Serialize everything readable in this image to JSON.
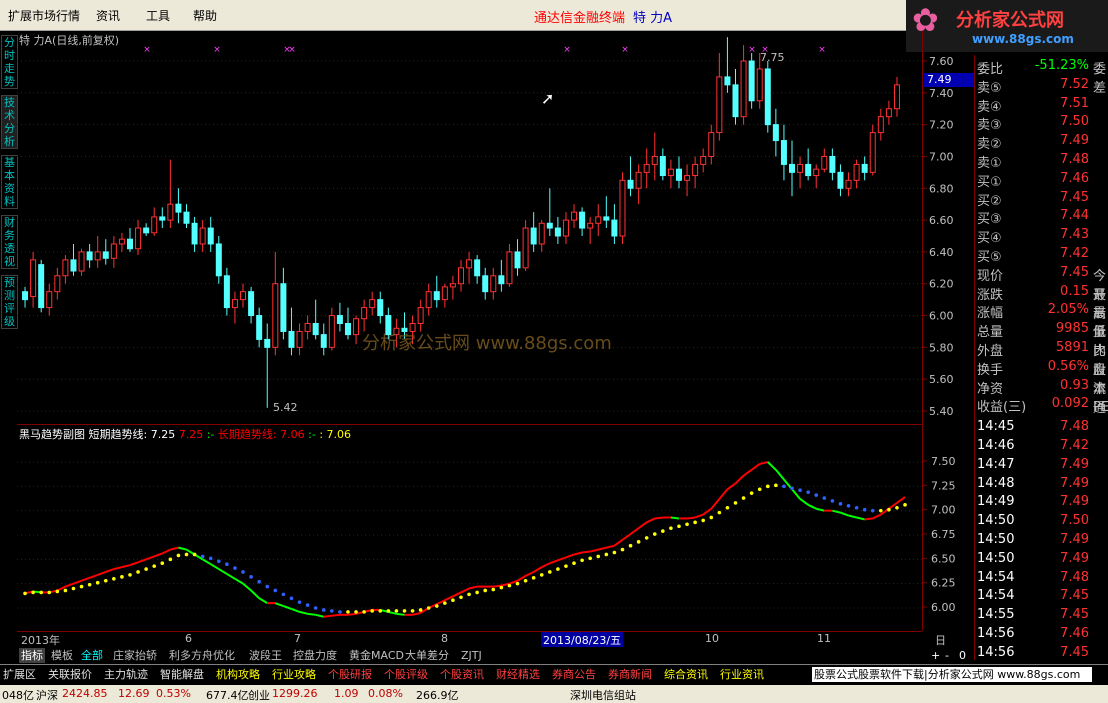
{
  "menubar": {
    "items": [
      "扩展市场行情",
      "资讯",
      "工具",
      "帮助"
    ],
    "app_title": "通达信金融终端",
    "stock_title": "特  力A",
    "logo_text": "分析家公式网",
    "logo_url": "www.88gs.com"
  },
  "sidetabs": [
    "分时走势",
    "技术分析",
    "基本资料",
    "财务透视",
    "预测评级"
  ],
  "main_chart": {
    "header": "特  力A(日线,前复权)",
    "price_axis": [
      "7.60",
      "7.40",
      "7.20",
      "7.00",
      "6.80",
      "6.60",
      "6.40",
      "6.20",
      "6.00",
      "5.80",
      "5.60",
      "5.40"
    ],
    "current_price_tag": "7.49",
    "high_label": "7.75",
    "low_label": "5.42",
    "watermark": "分析家公式网 www.88gs.com"
  },
  "sub_chart": {
    "title": "黑马趋势副图",
    "short_label": "短期趋势线:",
    "short_value": "7.25",
    "short_value2": "7.25",
    "dash1": ":-",
    "long_label": "长期趋势线:",
    "long_value": "7.06",
    "dash2": ":-",
    "long_value2": ": 7.06",
    "axis": [
      "7.50",
      "7.25",
      "7.00",
      "6.75",
      "6.50",
      "6.25",
      "6.00"
    ]
  },
  "xaxis": {
    "labels": [
      "2013年",
      "6",
      "7",
      "8",
      "2013/08/23/五",
      "10",
      "11"
    ],
    "period": "日线"
  },
  "bottom_tabs": [
    "指标",
    "模板",
    "全部",
    "庄家抬轿",
    "利多方舟优化",
    "波段王",
    "控盘力度",
    "黄金MACD",
    "大单差分",
    "ZJTJ"
  ],
  "bottom_ctrl": [
    "+",
    "-",
    "0"
  ],
  "funcbar": {
    "items": [
      "扩展区",
      "关联报价",
      "主力轨迹",
      "智能解盘",
      "机构攻略",
      "行业攻略",
      "个股研报",
      "个股评级",
      "个股资讯",
      "财经精选",
      "券商公告",
      "券商新闻",
      "综合资讯",
      "行业资讯"
    ],
    "ad": "股票公式股票软件下载|分析家公式网 www.88gs.com"
  },
  "statusbar": {
    "seg0": "048亿",
    "sh_label": "沪深",
    "sh_value": "2424.85",
    "sh_change": "12.69",
    "sh_pct": "0.53%",
    "sh_amount": "677.4亿",
    "cy_label": "创业",
    "cy_value": "1299.26",
    "cy_change": "1.09",
    "cy_pct": "0.08%",
    "cy_amount": "266.9亿",
    "tail": "深圳电信组站"
  },
  "quote": {
    "weibi": {
      "label": "委比",
      "value": "-51.23%",
      "right": "委差"
    },
    "sells": [
      {
        "label": "卖⑤",
        "price": "7.52"
      },
      {
        "label": "卖④",
        "price": "7.51"
      },
      {
        "label": "卖③",
        "price": "7.50"
      },
      {
        "label": "卖②",
        "price": "7.49"
      },
      {
        "label": "卖①",
        "price": "7.48"
      }
    ],
    "buys": [
      {
        "label": "买①",
        "price": "7.46"
      },
      {
        "label": "买②",
        "price": "7.45"
      },
      {
        "label": "买③",
        "price": "7.44"
      },
      {
        "label": "买④",
        "price": "7.43"
      },
      {
        "label": "买⑤",
        "price": "7.42"
      }
    ],
    "stats": [
      {
        "label": "现价",
        "value": "7.45",
        "right": "今开"
      },
      {
        "label": "涨跌",
        "value": "0.15",
        "right": "最高"
      },
      {
        "label": "涨幅",
        "value": "2.05%",
        "right": "最低"
      },
      {
        "label": "总量",
        "value": "9985",
        "right": "量比"
      },
      {
        "label": "外盘",
        "value": "5891",
        "right": "内盘"
      },
      {
        "label": "换手",
        "value": "0.56%",
        "right": "股本"
      },
      {
        "label": "净资",
        "value": "0.93",
        "right": "流通"
      },
      {
        "label": "收益(三)",
        "value": "0.092",
        "right": "PE(动"
      }
    ],
    "ticks": [
      {
        "time": "14:45",
        "price": "7.48",
        "color": "#ff3232"
      },
      {
        "time": "14:46",
        "price": "7.42",
        "color": "#ff3232"
      },
      {
        "time": "14:47",
        "price": "7.49",
        "color": "#ff3232"
      },
      {
        "time": "14:48",
        "price": "7.49",
        "color": "#ff3232"
      },
      {
        "time": "14:49",
        "price": "7.49",
        "color": "#ff3232"
      },
      {
        "time": "14:50",
        "price": "7.50",
        "color": "#ff3232"
      },
      {
        "time": "14:50",
        "price": "7.49",
        "color": "#ff3232"
      },
      {
        "time": "14:50",
        "price": "7.49",
        "color": "#ff3232"
      },
      {
        "time": "14:54",
        "price": "7.48",
        "color": "#ff3232"
      },
      {
        "time": "14:54",
        "price": "7.45",
        "color": "#ff3232"
      },
      {
        "time": "14:55",
        "price": "7.45",
        "color": "#ff3232"
      },
      {
        "time": "14:56",
        "price": "7.46",
        "color": "#ff3232"
      },
      {
        "time": "14:56",
        "price": "7.45",
        "color": "#ff3232"
      }
    ]
  },
  "colors": {
    "up": "#ff3232",
    "down": "#54ffff",
    "ma_short_up": "#ff0000",
    "ma_short_down": "#00ff00",
    "ma_long": "#ffff00",
    "ma_long_dots": "#3060ff",
    "grid": "#800000",
    "label_cyan": "#00c0c0"
  },
  "chart_data": {
    "type": "candlestick",
    "xlabel": "",
    "ylabel": "",
    "ylim": [
      5.4,
      7.6
    ],
    "ohlc": [
      [
        6.15,
        6.18,
        6.05,
        6.1
      ],
      [
        6.12,
        6.4,
        6.05,
        6.35
      ],
      [
        6.32,
        6.35,
        6.02,
        6.05
      ],
      [
        6.05,
        6.2,
        6.0,
        6.15
      ],
      [
        6.15,
        6.3,
        6.1,
        6.25
      ],
      [
        6.25,
        6.38,
        6.2,
        6.35
      ],
      [
        6.35,
        6.45,
        6.25,
        6.28
      ],
      [
        6.28,
        6.42,
        6.25,
        6.4
      ],
      [
        6.4,
        6.45,
        6.3,
        6.35
      ],
      [
        6.35,
        6.5,
        6.3,
        6.4
      ],
      [
        6.4,
        6.48,
        6.32,
        6.36
      ],
      [
        6.36,
        6.5,
        6.3,
        6.45
      ],
      [
        6.45,
        6.52,
        6.4,
        6.48
      ],
      [
        6.48,
        6.55,
        6.4,
        6.42
      ],
      [
        6.42,
        6.6,
        6.38,
        6.55
      ],
      [
        6.55,
        6.58,
        6.5,
        6.52
      ],
      [
        6.52,
        6.68,
        6.5,
        6.62
      ],
      [
        6.62,
        6.68,
        6.55,
        6.6
      ],
      [
        6.6,
        6.98,
        6.55,
        6.7
      ],
      [
        6.7,
        6.8,
        6.58,
        6.65
      ],
      [
        6.65,
        6.7,
        6.55,
        6.58
      ],
      [
        6.58,
        6.62,
        6.4,
        6.45
      ],
      [
        6.45,
        6.6,
        6.4,
        6.55
      ],
      [
        6.55,
        6.62,
        6.4,
        6.45
      ],
      [
        6.45,
        6.5,
        6.2,
        6.25
      ],
      [
        6.25,
        6.3,
        6.0,
        6.05
      ],
      [
        6.05,
        6.15,
        5.95,
        6.1
      ],
      [
        6.1,
        6.2,
        6.05,
        6.15
      ],
      [
        6.15,
        6.18,
        5.95,
        6.0
      ],
      [
        6.0,
        6.05,
        5.8,
        5.85
      ],
      [
        5.85,
        5.95,
        5.42,
        5.8
      ],
      [
        5.8,
        6.4,
        5.75,
        6.2
      ],
      [
        6.2,
        6.3,
        5.85,
        5.9
      ],
      [
        5.9,
        6.05,
        5.75,
        5.8
      ],
      [
        5.8,
        5.95,
        5.75,
        5.9
      ],
      [
        5.9,
        6.0,
        5.85,
        5.95
      ],
      [
        5.95,
        6.1,
        5.85,
        5.88
      ],
      [
        5.88,
        5.95,
        5.75,
        5.8
      ],
      [
        5.8,
        6.05,
        5.78,
        6.0
      ],
      [
        6.0,
        6.08,
        5.9,
        5.95
      ],
      [
        5.95,
        6.05,
        5.85,
        5.88
      ],
      [
        5.88,
        6.0,
        5.82,
        5.98
      ],
      [
        5.98,
        6.1,
        5.9,
        6.05
      ],
      [
        6.05,
        6.15,
        6.0,
        6.1
      ],
      [
        6.1,
        6.15,
        5.95,
        6.0
      ],
      [
        6.0,
        6.05,
        5.85,
        5.88
      ],
      [
        5.88,
        5.98,
        5.8,
        5.92
      ],
      [
        5.92,
        6.02,
        5.85,
        5.9
      ],
      [
        5.9,
        6.0,
        5.82,
        5.95
      ],
      [
        5.95,
        6.1,
        5.9,
        6.05
      ],
      [
        6.05,
        6.2,
        6.0,
        6.15
      ],
      [
        6.15,
        6.25,
        6.05,
        6.1
      ],
      [
        6.1,
        6.2,
        6.05,
        6.18
      ],
      [
        6.18,
        6.25,
        6.1,
        6.2
      ],
      [
        6.2,
        6.35,
        6.15,
        6.3
      ],
      [
        6.3,
        6.4,
        6.2,
        6.35
      ],
      [
        6.35,
        6.38,
        6.2,
        6.25
      ],
      [
        6.25,
        6.3,
        6.1,
        6.15
      ],
      [
        6.15,
        6.3,
        6.1,
        6.25
      ],
      [
        6.25,
        6.35,
        6.15,
        6.2
      ],
      [
        6.2,
        6.45,
        6.18,
        6.4
      ],
      [
        6.4,
        6.48,
        6.25,
        6.3
      ],
      [
        6.3,
        6.6,
        6.28,
        6.55
      ],
      [
        6.55,
        6.65,
        6.4,
        6.45
      ],
      [
        6.45,
        6.6,
        6.4,
        6.58
      ],
      [
        6.58,
        6.8,
        6.5,
        6.55
      ],
      [
        6.55,
        6.62,
        6.45,
        6.5
      ],
      [
        6.5,
        6.65,
        6.45,
        6.6
      ],
      [
        6.6,
        6.7,
        6.55,
        6.65
      ],
      [
        6.65,
        6.68,
        6.5,
        6.55
      ],
      [
        6.55,
        6.62,
        6.45,
        6.58
      ],
      [
        6.58,
        6.7,
        6.5,
        6.62
      ],
      [
        6.62,
        6.75,
        6.55,
        6.6
      ],
      [
        6.6,
        6.7,
        6.45,
        6.5
      ],
      [
        6.5,
        6.9,
        6.45,
        6.85
      ],
      [
        6.85,
        7.0,
        6.75,
        6.8
      ],
      [
        6.8,
        6.95,
        6.7,
        6.9
      ],
      [
        6.9,
        7.05,
        6.8,
        6.95
      ],
      [
        6.95,
        7.15,
        6.85,
        7.0
      ],
      [
        7.0,
        7.05,
        6.85,
        6.88
      ],
      [
        6.88,
        6.98,
        6.8,
        6.92
      ],
      [
        6.92,
        7.0,
        6.8,
        6.85
      ],
      [
        6.85,
        6.95,
        6.75,
        6.88
      ],
      [
        6.88,
        7.0,
        6.8,
        6.95
      ],
      [
        6.95,
        7.05,
        6.9,
        7.0
      ],
      [
        7.0,
        7.2,
        6.95,
        7.15
      ],
      [
        7.15,
        7.65,
        7.1,
        7.5
      ],
      [
        7.5,
        7.75,
        7.4,
        7.45
      ],
      [
        7.45,
        7.55,
        7.2,
        7.25
      ],
      [
        7.25,
        7.7,
        7.2,
        7.6
      ],
      [
        7.6,
        7.65,
        7.3,
        7.35
      ],
      [
        7.35,
        7.65,
        7.3,
        7.55
      ],
      [
        7.55,
        7.6,
        7.15,
        7.2
      ],
      [
        7.2,
        7.3,
        7.0,
        7.1
      ],
      [
        7.1,
        7.2,
        6.85,
        6.95
      ],
      [
        6.95,
        7.1,
        6.75,
        6.9
      ],
      [
        6.9,
        7.0,
        6.8,
        6.95
      ],
      [
        6.95,
        7.05,
        6.85,
        6.88
      ],
      [
        6.88,
        6.95,
        6.8,
        6.92
      ],
      [
        6.92,
        7.05,
        6.9,
        7.0
      ],
      [
        7.0,
        7.05,
        6.85,
        6.9
      ],
      [
        6.9,
        6.95,
        6.75,
        6.8
      ],
      [
        6.8,
        6.9,
        6.75,
        6.85
      ],
      [
        6.85,
        6.98,
        6.8,
        6.95
      ],
      [
        6.95,
        7.0,
        6.85,
        6.9
      ],
      [
        6.9,
        7.2,
        6.88,
        7.15
      ],
      [
        7.15,
        7.3,
        7.1,
        7.25
      ],
      [
        7.25,
        7.35,
        7.2,
        7.3
      ],
      [
        7.3,
        7.5,
        7.25,
        7.45
      ]
    ],
    "short_trend": [
      6.15,
      6.17,
      6.16,
      6.16,
      6.18,
      6.22,
      6.25,
      6.28,
      6.31,
      6.34,
      6.37,
      6.4,
      6.42,
      6.44,
      6.47,
      6.5,
      6.53,
      6.56,
      6.6,
      6.62,
      6.6,
      6.55,
      6.5,
      6.45,
      6.4,
      6.35,
      6.3,
      6.25,
      6.18,
      6.1,
      6.05,
      6.05,
      6.02,
      5.99,
      5.96,
      5.94,
      5.93,
      5.91,
      5.92,
      5.93,
      5.93,
      5.94,
      5.96,
      5.98,
      5.98,
      5.96,
      5.94,
      5.93,
      5.93,
      5.95,
      6.0,
      6.04,
      6.08,
      6.12,
      6.16,
      6.2,
      6.22,
      6.22,
      6.22,
      6.23,
      6.25,
      6.28,
      6.33,
      6.37,
      6.42,
      6.46,
      6.49,
      6.52,
      6.55,
      6.57,
      6.58,
      6.6,
      6.62,
      6.64,
      6.7,
      6.76,
      6.82,
      6.88,
      6.92,
      6.93,
      6.93,
      6.92,
      6.92,
      6.93,
      6.96,
      7.02,
      7.12,
      7.22,
      7.28,
      7.36,
      7.42,
      7.48,
      7.5,
      7.42,
      7.32,
      7.22,
      7.12,
      7.06,
      7.02,
      7.0,
      7.0,
      6.98,
      6.95,
      6.93,
      6.91,
      6.92,
      6.96,
      7.02,
      7.08,
      7.14
    ],
    "long_trend": [
      6.15,
      6.16,
      6.16,
      6.16,
      6.17,
      6.18,
      6.2,
      6.22,
      6.24,
      6.26,
      6.28,
      6.3,
      6.32,
      6.34,
      6.37,
      6.4,
      6.43,
      6.46,
      6.5,
      6.54,
      6.55,
      6.55,
      6.53,
      6.51,
      6.48,
      6.45,
      6.41,
      6.37,
      6.32,
      6.27,
      6.22,
      6.18,
      6.14,
      6.1,
      6.06,
      6.03,
      6.0,
      5.98,
      5.97,
      5.96,
      5.96,
      5.96,
      5.96,
      5.97,
      5.97,
      5.97,
      5.97,
      5.97,
      5.97,
      5.98,
      6.0,
      6.02,
      6.05,
      6.08,
      6.11,
      6.14,
      6.16,
      6.18,
      6.19,
      6.21,
      6.23,
      6.25,
      6.28,
      6.31,
      6.34,
      6.37,
      6.4,
      6.43,
      6.46,
      6.49,
      6.51,
      6.53,
      6.55,
      6.57,
      6.6,
      6.64,
      6.68,
      6.72,
      6.76,
      6.79,
      6.82,
      6.84,
      6.86,
      6.88,
      6.9,
      6.93,
      6.98,
      7.03,
      7.08,
      7.13,
      7.18,
      7.22,
      7.25,
      7.26,
      7.25,
      7.23,
      7.21,
      7.19,
      7.16,
      7.13,
      7.1,
      7.07,
      7.05,
      7.03,
      7.01,
      7.0,
      7.0,
      7.01,
      7.03,
      7.06
    ]
  }
}
